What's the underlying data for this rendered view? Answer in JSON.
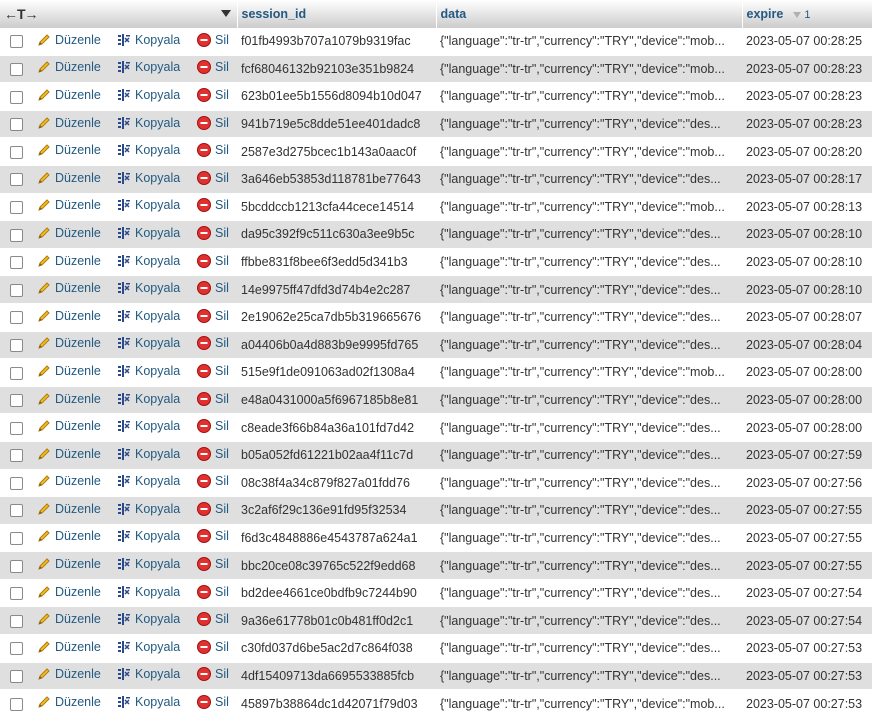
{
  "header": {
    "nav_arrows": "←T→",
    "col_session": "session_id",
    "col_data": "data",
    "col_expire": "expire",
    "expire_sort_order": "1"
  },
  "labels": {
    "edit": "Düzenle",
    "copy": "Kopyala",
    "delete": "Sil"
  },
  "rows": [
    {
      "session_id": "f01fb4993b707a1079b9319fac",
      "data": "{\"language\":\"tr-tr\",\"currency\":\"TRY\",\"device\":\"mob...",
      "expire": "2023-05-07 00:28:25"
    },
    {
      "session_id": "fcf68046132b92103e351b9824",
      "data": "{\"language\":\"tr-tr\",\"currency\":\"TRY\",\"device\":\"mob...",
      "expire": "2023-05-07 00:28:23"
    },
    {
      "session_id": "623b01ee5b1556d8094b10d047",
      "data": "{\"language\":\"tr-tr\",\"currency\":\"TRY\",\"device\":\"mob...",
      "expire": "2023-05-07 00:28:23"
    },
    {
      "session_id": "941b719e5c8dde51ee401dadc8",
      "data": "{\"language\":\"tr-tr\",\"currency\":\"TRY\",\"device\":\"des...",
      "expire": "2023-05-07 00:28:23"
    },
    {
      "session_id": "2587e3d275bcec1b143a0aac0f",
      "data": "{\"language\":\"tr-tr\",\"currency\":\"TRY\",\"device\":\"mob...",
      "expire": "2023-05-07 00:28:20"
    },
    {
      "session_id": "3a646eb53853d118781be77643",
      "data": "{\"language\":\"tr-tr\",\"currency\":\"TRY\",\"device\":\"des...",
      "expire": "2023-05-07 00:28:17"
    },
    {
      "session_id": "5bcddccb1213cfa44cece14514",
      "data": "{\"language\":\"tr-tr\",\"currency\":\"TRY\",\"device\":\"mob...",
      "expire": "2023-05-07 00:28:13"
    },
    {
      "session_id": "da95c392f9c511c630a3ee9b5c",
      "data": "{\"language\":\"tr-tr\",\"currency\":\"TRY\",\"device\":\"des...",
      "expire": "2023-05-07 00:28:10"
    },
    {
      "session_id": "ffbbe831f8bee6f3edd5d341b3",
      "data": "{\"language\":\"tr-tr\",\"currency\":\"TRY\",\"device\":\"des...",
      "expire": "2023-05-07 00:28:10"
    },
    {
      "session_id": "14e9975ff47dfd3d74b4e2c287",
      "data": "{\"language\":\"tr-tr\",\"currency\":\"TRY\",\"device\":\"des...",
      "expire": "2023-05-07 00:28:10"
    },
    {
      "session_id": "2e19062e25ca7db5b319665676",
      "data": "{\"language\":\"tr-tr\",\"currency\":\"TRY\",\"device\":\"des...",
      "expire": "2023-05-07 00:28:07"
    },
    {
      "session_id": "a04406b0a4d883b9e9995fd765",
      "data": "{\"language\":\"tr-tr\",\"currency\":\"TRY\",\"device\":\"des...",
      "expire": "2023-05-07 00:28:04"
    },
    {
      "session_id": "515e9f1de091063ad02f1308a4",
      "data": "{\"language\":\"tr-tr\",\"currency\":\"TRY\",\"device\":\"mob...",
      "expire": "2023-05-07 00:28:00"
    },
    {
      "session_id": "e48a0431000a5f6967185b8e81",
      "data": "{\"language\":\"tr-tr\",\"currency\":\"TRY\",\"device\":\"des...",
      "expire": "2023-05-07 00:28:00"
    },
    {
      "session_id": "c8eade3f66b84a36a101fd7d42",
      "data": "{\"language\":\"tr-tr\",\"currency\":\"TRY\",\"device\":\"des...",
      "expire": "2023-05-07 00:28:00"
    },
    {
      "session_id": "b05a052fd61221b02aa4f11c7d",
      "data": "{\"language\":\"tr-tr\",\"currency\":\"TRY\",\"device\":\"des...",
      "expire": "2023-05-07 00:27:59"
    },
    {
      "session_id": "08c38f4a34c879f827a01fdd76",
      "data": "{\"language\":\"tr-tr\",\"currency\":\"TRY\",\"device\":\"des...",
      "expire": "2023-05-07 00:27:56"
    },
    {
      "session_id": "3c2af6f29c136e91fd95f32534",
      "data": "{\"language\":\"tr-tr\",\"currency\":\"TRY\",\"device\":\"des...",
      "expire": "2023-05-07 00:27:55"
    },
    {
      "session_id": "f6d3c4848886e4543787a624a1",
      "data": "{\"language\":\"tr-tr\",\"currency\":\"TRY\",\"device\":\"des...",
      "expire": "2023-05-07 00:27:55"
    },
    {
      "session_id": "bbc20ce08c39765c522f9edd68",
      "data": "{\"language\":\"tr-tr\",\"currency\":\"TRY\",\"device\":\"des...",
      "expire": "2023-05-07 00:27:55"
    },
    {
      "session_id": "bd2dee4661ce0bdfb9c7244b90",
      "data": "{\"language\":\"tr-tr\",\"currency\":\"TRY\",\"device\":\"des...",
      "expire": "2023-05-07 00:27:54"
    },
    {
      "session_id": "9a36e61778b01c0b481ff0d2c1",
      "data": "{\"language\":\"tr-tr\",\"currency\":\"TRY\",\"device\":\"des...",
      "expire": "2023-05-07 00:27:54"
    },
    {
      "session_id": "c30fd037d6be5ac2d7c864f038",
      "data": "{\"language\":\"tr-tr\",\"currency\":\"TRY\",\"device\":\"des...",
      "expire": "2023-05-07 00:27:53"
    },
    {
      "session_id": "4df15409713da6695533885fcb",
      "data": "{\"language\":\"tr-tr\",\"currency\":\"TRY\",\"device\":\"des...",
      "expire": "2023-05-07 00:27:53"
    },
    {
      "session_id": "45897b38864dc1d42071f79d03",
      "data": "{\"language\":\"tr-tr\",\"currency\":\"TRY\",\"device\":\"mob...",
      "expire": "2023-05-07 00:27:53"
    }
  ]
}
